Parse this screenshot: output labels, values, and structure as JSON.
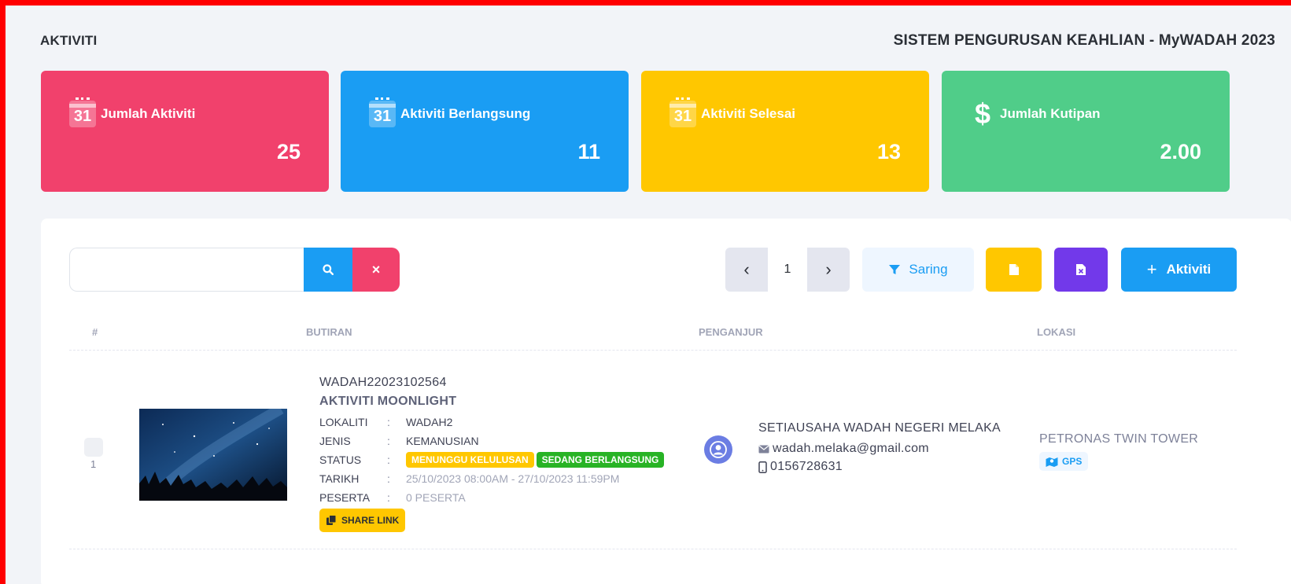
{
  "header": {
    "page_title": "AKTIVITI",
    "system_title": "SISTEM PENGURUSAN KEAHLIAN - MyWADAH 2023"
  },
  "stats": [
    {
      "label": "Jumlah Aktiviti",
      "value": "25",
      "icon": "calendar-icon",
      "icon_text": "31",
      "color": "#f1416c"
    },
    {
      "label": "Aktiviti Berlangsung",
      "value": "11",
      "icon": "calendar-icon",
      "icon_text": "31",
      "color": "#1a9df3"
    },
    {
      "label": "Aktiviti Selesai",
      "value": "13",
      "icon": "calendar-icon",
      "icon_text": "31",
      "color": "#ffc700"
    },
    {
      "label": "Jumlah Kutipan",
      "value": "2.00",
      "icon": "dollar-icon",
      "icon_text": "$",
      "color": "#50cd89"
    }
  ],
  "toolbar": {
    "search_placeholder": "",
    "page_number": "1",
    "filter_label": "Saring",
    "add_label": "Aktiviti"
  },
  "table": {
    "columns": [
      "#",
      "BUTIRAN",
      "PENGANJUR",
      "LOKASI"
    ],
    "rows": [
      {
        "number": "1",
        "code": "WADAH22023102564",
        "name": "AKTIVITI MOONLIGHT",
        "fields": {
          "lokaliti_label": "LOKALITI",
          "lokaliti": "WADAH2",
          "jenis_label": "JENIS",
          "jenis": "KEMANUSIAN",
          "status_label": "STATUS",
          "status_badges": [
            "MENUNGGU KELULUSAN",
            "SEDANG BERLANGSUNG"
          ],
          "tarikh_label": "TARIKH",
          "tarikh": "25/10/2023 08:00AM - 27/10/2023 11:59PM",
          "peserta_label": "PESERTA",
          "peserta": "0 PESERTA"
        },
        "share_label": "SHARE LINK",
        "organizer": {
          "name": "SETIAUSAHA WADAH NEGERI MELAKA",
          "email": "wadah.melaka@gmail.com",
          "phone": "0156728631"
        },
        "location": {
          "name": "PETRONAS TWIN TOWER",
          "gps_label": "GPS"
        }
      }
    ]
  },
  "colors": {
    "primary": "#1a9df3",
    "danger": "#f1416c",
    "warning": "#ffc700",
    "success": "#50cd89",
    "purple": "#7239ea",
    "green_badge": "#28b325"
  }
}
